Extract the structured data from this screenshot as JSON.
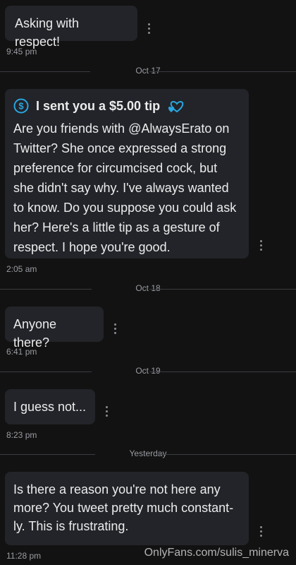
{
  "messages": [
    {
      "text": "Asking with respect!",
      "time": "9:45 pm"
    },
    {
      "tip_title": "I sent you a $5.00 tip",
      "text": "Are you friends with @AlwaysErato on\nTwitter? She once expressed a strong\npreference for circumcised cock, but\nshe didn't say why. I've always wanted\nto know. Do you suppose you could ask\nher? Here's a little tip as a gesture of\nrespect. I hope you're good.",
      "time": "2:05 am"
    },
    {
      "text": "Anyone there?",
      "time": "6:41 pm"
    },
    {
      "text": "I guess not...",
      "time": "8:23 pm"
    },
    {
      "text": "Is there a reason you're not here any\nmore? You tweet pretty much constant-\nly. This is frustrating.",
      "time": "11:28 pm"
    }
  ],
  "dividers": [
    "Oct 17",
    "Oct 18",
    "Oct 19",
    "Yesterday"
  ],
  "watermark": "OnlyFans.com/sulis_minerva",
  "colors": {
    "background": "#121212",
    "bubble": "#222429",
    "tip_accent": "#29a6e0"
  },
  "icons": {
    "tip": "dollar-circle-icon",
    "heart": "double-heart-icon",
    "more": "kebab-menu-icon"
  }
}
